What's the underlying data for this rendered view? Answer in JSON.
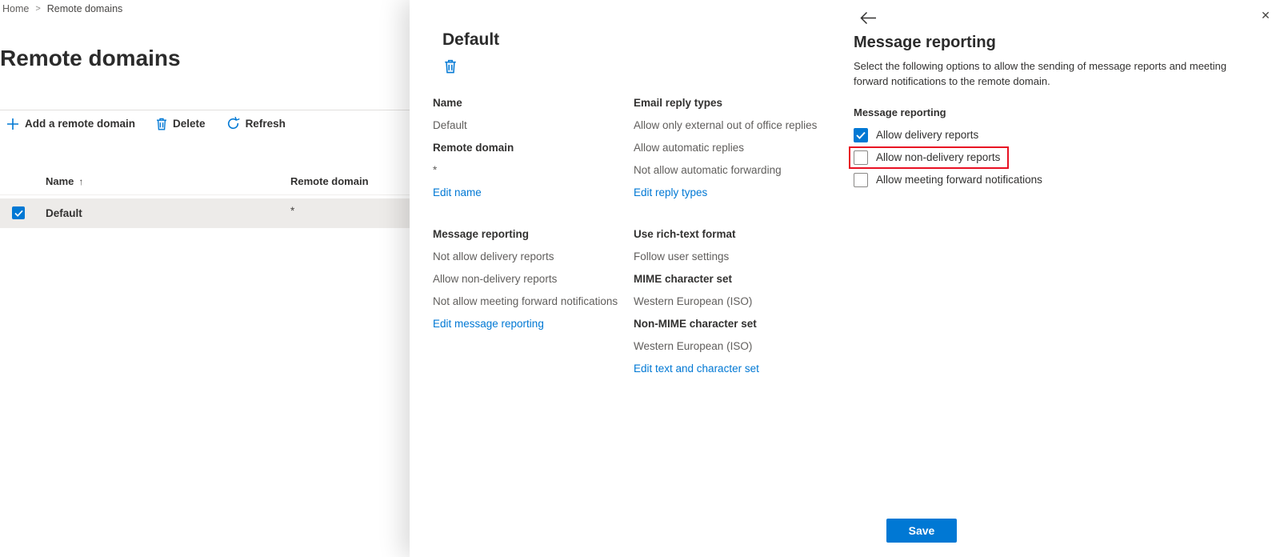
{
  "colors": {
    "accent": "#0078d4",
    "highlight_red": "#e81123",
    "row_selected_bg": "#edebe9"
  },
  "breadcrumb": {
    "home": "Home",
    "separator": ">",
    "current": "Remote domains"
  },
  "page": {
    "title": "Remote domains"
  },
  "toolbar": {
    "add_label": "Add a remote domain",
    "delete_label": "Delete",
    "refresh_label": "Refresh"
  },
  "table": {
    "columns": {
      "name": "Name",
      "remote_domain": "Remote domain"
    },
    "sort_arrow": "↑",
    "rows": [
      {
        "name": "Default",
        "remote_domain": "*",
        "selected": true
      }
    ]
  },
  "detail": {
    "title": "Default",
    "name_label": "Name",
    "name_value": "Default",
    "remote_domain_label": "Remote domain",
    "remote_domain_value": "*",
    "edit_name_link": "Edit name",
    "email_reply_label": "Email reply types",
    "email_reply_values": [
      "Allow only external out of office replies",
      "Allow automatic replies",
      "Not allow automatic forwarding"
    ],
    "edit_reply_link": "Edit reply types",
    "message_reporting_label": "Message reporting",
    "message_reporting_values": [
      "Not allow delivery reports",
      "Allow non-delivery reports",
      "Not allow meeting forward notifications"
    ],
    "edit_message_link": "Edit message reporting",
    "rich_text_label": "Use rich-text format",
    "rich_text_value": "Follow user settings",
    "mime_label": "MIME character set",
    "mime_value": "Western European (ISO)",
    "non_mime_label": "Non-MIME character set",
    "non_mime_value": "Western European (ISO)",
    "edit_text_link": "Edit text and character set"
  },
  "edit_panel": {
    "title": "Message reporting",
    "description": "Select the following options to allow the sending of message reports and meeting forward notifications to the remote domain.",
    "group_label": "Message reporting",
    "options": [
      {
        "label": "Allow delivery reports",
        "checked": true,
        "highlighted": false
      },
      {
        "label": "Allow non-delivery reports",
        "checked": false,
        "highlighted": true
      },
      {
        "label": "Allow meeting forward notifications",
        "checked": false,
        "highlighted": false
      }
    ],
    "save_label": "Save",
    "close_glyph": "✕"
  }
}
